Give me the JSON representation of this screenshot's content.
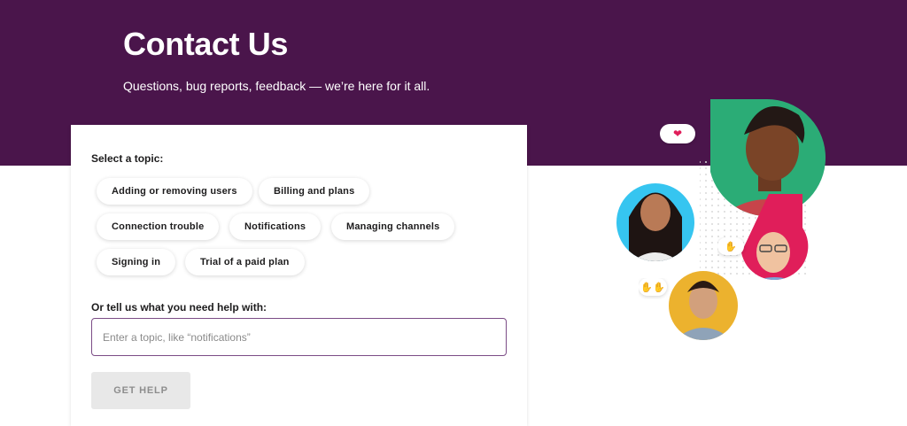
{
  "colors": {
    "brand": "#4a154b",
    "accent": "#7b4c86",
    "button_bg": "#e8e8e8",
    "teal": "#2bac76",
    "cyan": "#36c5f0",
    "pink": "#e01e5a",
    "yellow": "#ecb22e"
  },
  "header": {
    "title": "Contact Us",
    "subtitle": "Questions, bug reports, feedback — we’re here for it all."
  },
  "form": {
    "topic_label": "Select a topic:",
    "topics": [
      "Adding or removing users",
      "Billing and plans",
      "Connection trouble",
      "Notifications",
      "Managing channels",
      "Signing in",
      "Trial of a paid plan"
    ],
    "help_label": "Or tell us what you need help with:",
    "help_placeholder": "Enter a topic, like “notifications”",
    "help_value": "",
    "submit_label": "GET HELP"
  },
  "illustration": {
    "icons": [
      "heart-emoji-icon",
      "clapping-hands-emoji-icon",
      "raised-hands-emoji-icon"
    ],
    "avatars": [
      "avatar-woman-smiling",
      "avatar-woman-long-hair",
      "avatar-man-glasses",
      "avatar-person-short-hair"
    ]
  }
}
